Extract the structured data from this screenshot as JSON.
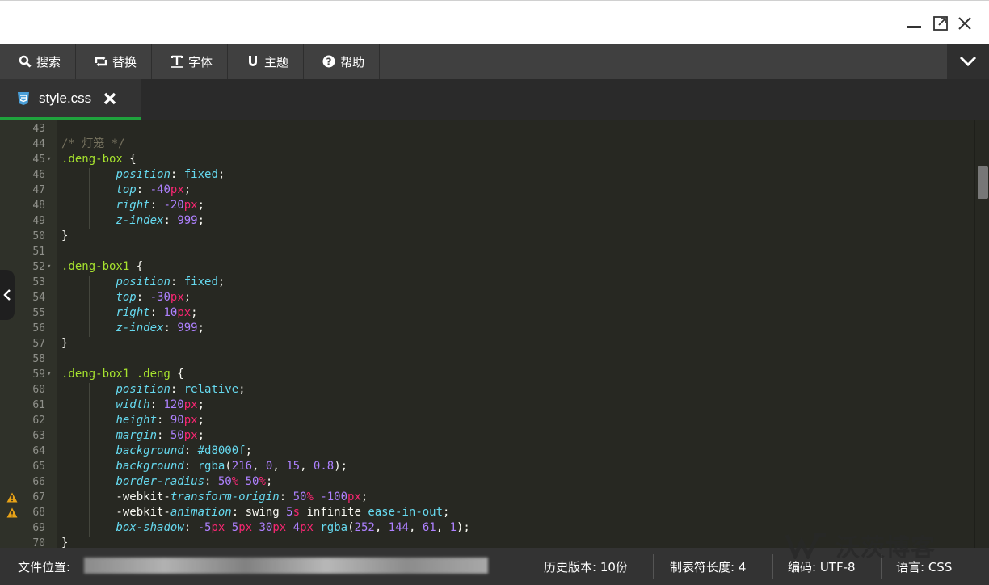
{
  "toolbar": {
    "items": [
      {
        "label": "搜索",
        "icon": "search-icon"
      },
      {
        "label": "替换",
        "icon": "replace-icon"
      },
      {
        "label": "字体",
        "icon": "font-icon"
      },
      {
        "label": "主题",
        "icon": "theme-icon"
      },
      {
        "label": "帮助",
        "icon": "help-icon"
      }
    ]
  },
  "tab": {
    "label": "style.css",
    "icon": "css3-icon"
  },
  "editor": {
    "lines": [
      {
        "n": "43",
        "tokens": []
      },
      {
        "n": "44",
        "tokens": [
          {
            "t": "/* 灯笼 */",
            "c": "c-comment"
          }
        ]
      },
      {
        "n": "45",
        "fold": true,
        "tokens": [
          {
            "t": ".deng-box",
            "c": "c-sel"
          },
          {
            "t": " {",
            "c": "c-plain"
          }
        ]
      },
      {
        "n": "46",
        "tokens": [
          {
            "t": "        ",
            "c": "c-plain"
          },
          {
            "t": "position",
            "c": "c-prop"
          },
          {
            "t": ": ",
            "c": "c-plain"
          },
          {
            "t": "fixed",
            "c": "c-val"
          },
          {
            "t": ";",
            "c": "c-plain"
          }
        ]
      },
      {
        "n": "47",
        "tokens": [
          {
            "t": "        ",
            "c": "c-plain"
          },
          {
            "t": "top",
            "c": "c-prop"
          },
          {
            "t": ": ",
            "c": "c-plain"
          },
          {
            "t": "-40",
            "c": "c-num"
          },
          {
            "t": "px",
            "c": "c-unit"
          },
          {
            "t": ";",
            "c": "c-plain"
          }
        ]
      },
      {
        "n": "48",
        "tokens": [
          {
            "t": "        ",
            "c": "c-plain"
          },
          {
            "t": "right",
            "c": "c-prop"
          },
          {
            "t": ": ",
            "c": "c-plain"
          },
          {
            "t": "-20",
            "c": "c-num"
          },
          {
            "t": "px",
            "c": "c-unit"
          },
          {
            "t": ";",
            "c": "c-plain"
          }
        ]
      },
      {
        "n": "49",
        "tokens": [
          {
            "t": "        ",
            "c": "c-plain"
          },
          {
            "t": "z-index",
            "c": "c-prop"
          },
          {
            "t": ": ",
            "c": "c-plain"
          },
          {
            "t": "999",
            "c": "c-num"
          },
          {
            "t": ";",
            "c": "c-plain"
          }
        ]
      },
      {
        "n": "50",
        "tokens": [
          {
            "t": "}",
            "c": "c-plain"
          }
        ]
      },
      {
        "n": "51",
        "tokens": []
      },
      {
        "n": "52",
        "fold": true,
        "tokens": [
          {
            "t": ".deng-box1",
            "c": "c-sel"
          },
          {
            "t": " {",
            "c": "c-plain"
          }
        ]
      },
      {
        "n": "53",
        "tokens": [
          {
            "t": "        ",
            "c": "c-plain"
          },
          {
            "t": "position",
            "c": "c-prop"
          },
          {
            "t": ": ",
            "c": "c-plain"
          },
          {
            "t": "fixed",
            "c": "c-val"
          },
          {
            "t": ";",
            "c": "c-plain"
          }
        ]
      },
      {
        "n": "54",
        "tokens": [
          {
            "t": "        ",
            "c": "c-plain"
          },
          {
            "t": "top",
            "c": "c-prop"
          },
          {
            "t": ": ",
            "c": "c-plain"
          },
          {
            "t": "-30",
            "c": "c-num"
          },
          {
            "t": "px",
            "c": "c-unit"
          },
          {
            "t": ";",
            "c": "c-plain"
          }
        ]
      },
      {
        "n": "55",
        "tokens": [
          {
            "t": "        ",
            "c": "c-plain"
          },
          {
            "t": "right",
            "c": "c-prop"
          },
          {
            "t": ": ",
            "c": "c-plain"
          },
          {
            "t": "10",
            "c": "c-num"
          },
          {
            "t": "px",
            "c": "c-unit"
          },
          {
            "t": ";",
            "c": "c-plain"
          }
        ]
      },
      {
        "n": "56",
        "tokens": [
          {
            "t": "        ",
            "c": "c-plain"
          },
          {
            "t": "z-index",
            "c": "c-prop"
          },
          {
            "t": ": ",
            "c": "c-plain"
          },
          {
            "t": "999",
            "c": "c-num"
          },
          {
            "t": ";",
            "c": "c-plain"
          }
        ]
      },
      {
        "n": "57",
        "tokens": [
          {
            "t": "}",
            "c": "c-plain"
          }
        ]
      },
      {
        "n": "58",
        "tokens": []
      },
      {
        "n": "59",
        "fold": true,
        "tokens": [
          {
            "t": ".deng-box1 .deng",
            "c": "c-sel"
          },
          {
            "t": " {",
            "c": "c-plain"
          }
        ]
      },
      {
        "n": "60",
        "tokens": [
          {
            "t": "        ",
            "c": "c-plain"
          },
          {
            "t": "position",
            "c": "c-prop"
          },
          {
            "t": ": ",
            "c": "c-plain"
          },
          {
            "t": "relative",
            "c": "c-val"
          },
          {
            "t": ";",
            "c": "c-plain"
          }
        ]
      },
      {
        "n": "61",
        "tokens": [
          {
            "t": "        ",
            "c": "c-plain"
          },
          {
            "t": "width",
            "c": "c-prop"
          },
          {
            "t": ": ",
            "c": "c-plain"
          },
          {
            "t": "120",
            "c": "c-num"
          },
          {
            "t": "px",
            "c": "c-unit"
          },
          {
            "t": ";",
            "c": "c-plain"
          }
        ]
      },
      {
        "n": "62",
        "tokens": [
          {
            "t": "        ",
            "c": "c-plain"
          },
          {
            "t": "height",
            "c": "c-prop"
          },
          {
            "t": ": ",
            "c": "c-plain"
          },
          {
            "t": "90",
            "c": "c-num"
          },
          {
            "t": "px",
            "c": "c-unit"
          },
          {
            "t": ";",
            "c": "c-plain"
          }
        ]
      },
      {
        "n": "63",
        "tokens": [
          {
            "t": "        ",
            "c": "c-plain"
          },
          {
            "t": "margin",
            "c": "c-prop"
          },
          {
            "t": ": ",
            "c": "c-plain"
          },
          {
            "t": "50",
            "c": "c-num"
          },
          {
            "t": "px",
            "c": "c-unit"
          },
          {
            "t": ";",
            "c": "c-plain"
          }
        ]
      },
      {
        "n": "64",
        "tokens": [
          {
            "t": "        ",
            "c": "c-plain"
          },
          {
            "t": "background",
            "c": "c-prop"
          },
          {
            "t": ": ",
            "c": "c-plain"
          },
          {
            "t": "#d8000f",
            "c": "c-val"
          },
          {
            "t": ";",
            "c": "c-plain"
          }
        ]
      },
      {
        "n": "65",
        "tokens": [
          {
            "t": "        ",
            "c": "c-plain"
          },
          {
            "t": "background",
            "c": "c-prop"
          },
          {
            "t": ": ",
            "c": "c-plain"
          },
          {
            "t": "rgba",
            "c": "c-val"
          },
          {
            "t": "(",
            "c": "c-plain"
          },
          {
            "t": "216",
            "c": "c-num"
          },
          {
            "t": ", ",
            "c": "c-plain"
          },
          {
            "t": "0",
            "c": "c-num"
          },
          {
            "t": ", ",
            "c": "c-plain"
          },
          {
            "t": "15",
            "c": "c-num"
          },
          {
            "t": ", ",
            "c": "c-plain"
          },
          {
            "t": "0.8",
            "c": "c-num"
          },
          {
            "t": ");",
            "c": "c-plain"
          }
        ]
      },
      {
        "n": "66",
        "tokens": [
          {
            "t": "        ",
            "c": "c-plain"
          },
          {
            "t": "border-radius",
            "c": "c-prop"
          },
          {
            "t": ": ",
            "c": "c-plain"
          },
          {
            "t": "50",
            "c": "c-num"
          },
          {
            "t": "%",
            "c": "c-unit"
          },
          {
            "t": " ",
            "c": "c-plain"
          },
          {
            "t": "50",
            "c": "c-num"
          },
          {
            "t": "%",
            "c": "c-unit"
          },
          {
            "t": ";",
            "c": "c-plain"
          }
        ]
      },
      {
        "n": "67",
        "warn": true,
        "tokens": [
          {
            "t": "        -webkit-",
            "c": "c-plain"
          },
          {
            "t": "transform-origin",
            "c": "c-prop"
          },
          {
            "t": ": ",
            "c": "c-plain"
          },
          {
            "t": "50",
            "c": "c-num"
          },
          {
            "t": "%",
            "c": "c-unit"
          },
          {
            "t": " ",
            "c": "c-plain"
          },
          {
            "t": "-100",
            "c": "c-num"
          },
          {
            "t": "px",
            "c": "c-unit"
          },
          {
            "t": ";",
            "c": "c-plain"
          }
        ]
      },
      {
        "n": "68",
        "warn": true,
        "tokens": [
          {
            "t": "        -webkit-",
            "c": "c-plain"
          },
          {
            "t": "animation",
            "c": "c-prop"
          },
          {
            "t": ": ",
            "c": "c-plain"
          },
          {
            "t": "swing ",
            "c": "c-plain"
          },
          {
            "t": "5",
            "c": "c-num"
          },
          {
            "t": "s",
            "c": "c-unit"
          },
          {
            "t": " infinite ",
            "c": "c-plain"
          },
          {
            "t": "ease-in-out",
            "c": "c-val"
          },
          {
            "t": ";",
            "c": "c-plain"
          }
        ]
      },
      {
        "n": "69",
        "tokens": [
          {
            "t": "        ",
            "c": "c-plain"
          },
          {
            "t": "box-shadow",
            "c": "c-prop"
          },
          {
            "t": ": ",
            "c": "c-plain"
          },
          {
            "t": "-5",
            "c": "c-num"
          },
          {
            "t": "px",
            "c": "c-unit"
          },
          {
            "t": " ",
            "c": "c-plain"
          },
          {
            "t": "5",
            "c": "c-num"
          },
          {
            "t": "px",
            "c": "c-unit"
          },
          {
            "t": " ",
            "c": "c-plain"
          },
          {
            "t": "30",
            "c": "c-num"
          },
          {
            "t": "px",
            "c": "c-unit"
          },
          {
            "t": " ",
            "c": "c-plain"
          },
          {
            "t": "4",
            "c": "c-num"
          },
          {
            "t": "px",
            "c": "c-unit"
          },
          {
            "t": " ",
            "c": "c-plain"
          },
          {
            "t": "rgba",
            "c": "c-val"
          },
          {
            "t": "(",
            "c": "c-plain"
          },
          {
            "t": "252",
            "c": "c-num"
          },
          {
            "t": ", ",
            "c": "c-plain"
          },
          {
            "t": "144",
            "c": "c-num"
          },
          {
            "t": ", ",
            "c": "c-plain"
          },
          {
            "t": "61",
            "c": "c-num"
          },
          {
            "t": ", ",
            "c": "c-plain"
          },
          {
            "t": "1",
            "c": "c-num"
          },
          {
            "t": ");",
            "c": "c-plain"
          }
        ]
      },
      {
        "n": "70",
        "tokens": [
          {
            "t": "}",
            "c": "c-plain"
          }
        ]
      }
    ]
  },
  "statusbar": {
    "file_location_label": "文件位置:",
    "history_label": "历史版本: 10份",
    "tab_length_label": "制表符长度: 4",
    "encoding_label": "编码: UTF-8",
    "language_label": "语言: CSS"
  },
  "watermark": {
    "text": "沃茨博客"
  },
  "colors": {
    "toolbar_bg": "#404040",
    "tab_active_border": "#1fa33d",
    "editor_bg": "#272822",
    "warning": "#e8a317"
  }
}
